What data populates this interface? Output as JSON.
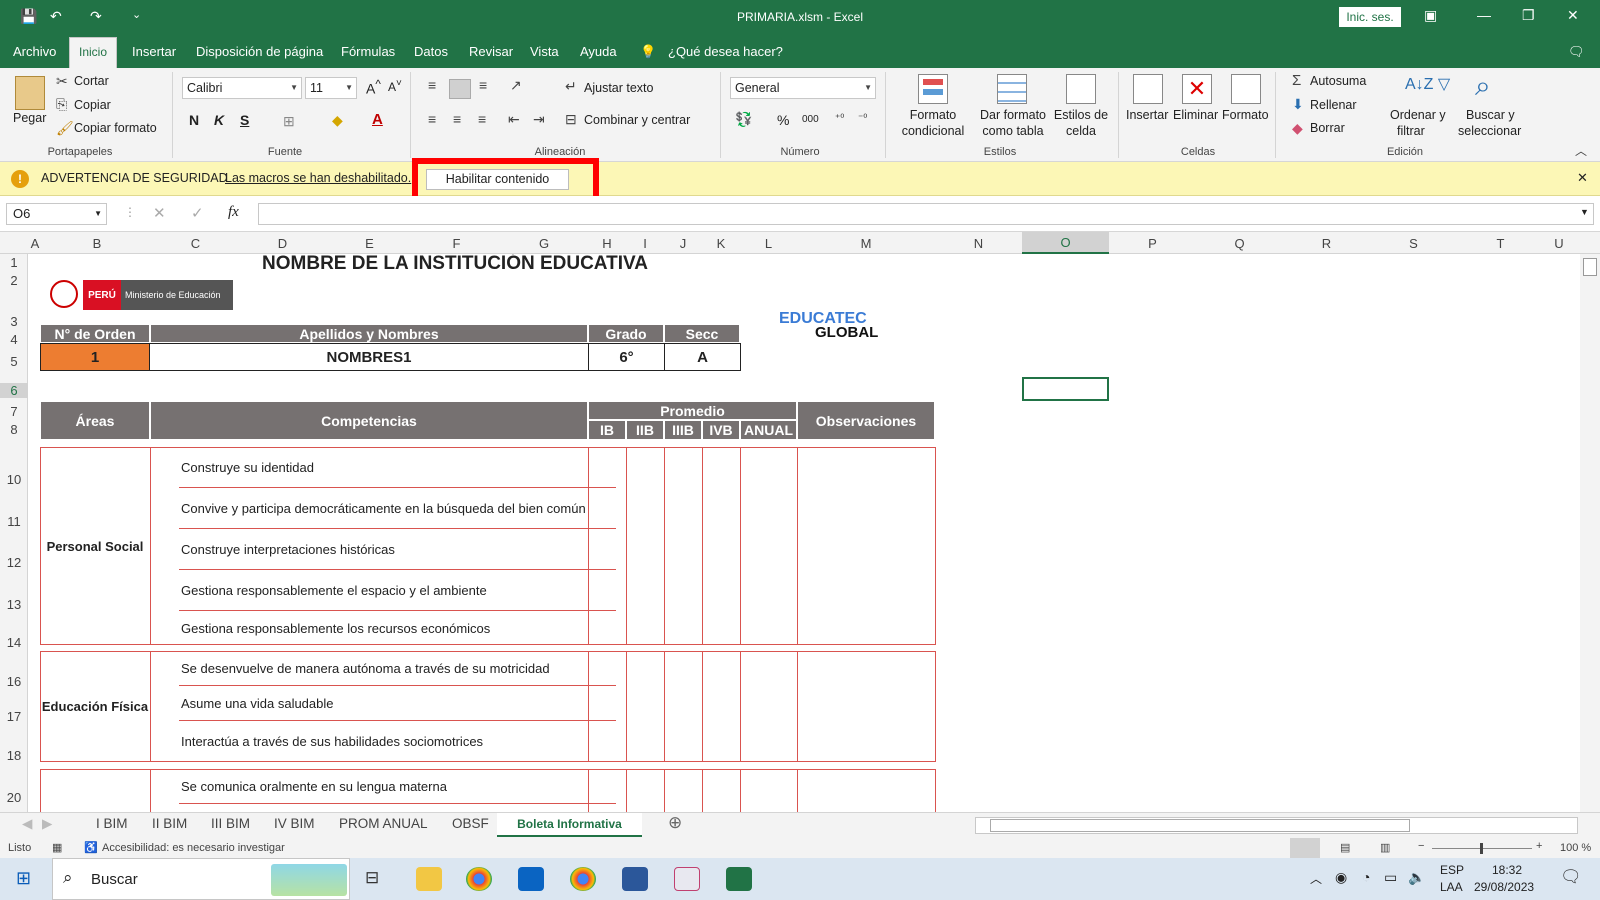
{
  "window": {
    "title": "PRIMARIA.xlsm  -  Excel",
    "signin": "Inic. ses."
  },
  "tabs": [
    "Archivo",
    "Inicio",
    "Insertar",
    "Disposición de página",
    "Fórmulas",
    "Datos",
    "Revisar",
    "Vista",
    "Ayuda"
  ],
  "tell_me": "¿Qué desea hacer?",
  "ribbon": {
    "clipboard": {
      "paste": "Pegar",
      "cut": "Cortar",
      "copy": "Copiar",
      "format_painter": "Copiar formato",
      "group": "Portapapeles"
    },
    "font": {
      "name": "Calibri",
      "size": "11",
      "bold": "N",
      "italic": "K",
      "underline": "S",
      "group": "Fuente"
    },
    "alignment": {
      "wrap": "Ajustar texto",
      "merge": "Combinar y centrar",
      "group": "Alineación"
    },
    "number": {
      "format": "General",
      "group": "Número"
    },
    "styles": {
      "conditional_1": "Formato",
      "conditional_2": "condicional",
      "table_1": "Dar formato",
      "table_2": "como tabla",
      "cell_1": "Estilos de",
      "cell_2": "celda",
      "group": "Estilos"
    },
    "cells": {
      "insert": "Insertar",
      "delete": "Eliminar",
      "format": "Formato",
      "group": "Celdas"
    },
    "editing": {
      "autosum": "Autosuma",
      "fill": "Rellenar",
      "clear": "Borrar",
      "sort_1": "Ordenar y",
      "sort_2": "filtrar",
      "find_1": "Buscar y",
      "find_2": "seleccionar",
      "group": "Edición"
    }
  },
  "security": {
    "title": "ADVERTENCIA DE SEGURIDAD",
    "message": "Las macros se han deshabilitado.",
    "button": "Habilitar contenido"
  },
  "formula_bar": {
    "name_box": "O6",
    "fx": "fx",
    "value": ""
  },
  "columns": [
    "A",
    "B",
    "C",
    "D",
    "E",
    "F",
    "G",
    "H",
    "I",
    "J",
    "K",
    "L",
    "M",
    "N",
    "O",
    "P",
    "Q",
    "R",
    "S",
    "T",
    "U"
  ],
  "rows": [
    "1",
    "2",
    "3",
    "4",
    "5",
    "6",
    "7",
    "8",
    "10",
    "11",
    "12",
    "13",
    "14",
    "16",
    "17",
    "18",
    "20"
  ],
  "sheet": {
    "institution": "NOMBRE DE LA INSTITUCIÓN EDUCATIVA",
    "logo_peru": "PERÚ",
    "logo_minedu": "Ministerio de Educación",
    "logo_educatec_1": "EDUCATEC",
    "logo_educatec_2": "GLOBAL",
    "student_headers": [
      "N° de Orden",
      "Apellidos y Nombres",
      "Grado",
      "Secc"
    ],
    "student_values": [
      "1",
      "NOMBRES1",
      "6°",
      "A"
    ],
    "table_headers": {
      "areas": "Áreas",
      "competencias": "Competencias",
      "promedio": "Promedio",
      "observaciones": "Observaciones",
      "periods": [
        "IB",
        "IIB",
        "IIIB",
        "IVB",
        "ANUAL"
      ]
    },
    "areas": [
      {
        "name": "Personal Social",
        "competencies": [
          "Construye su identidad",
          "Convive y participa democráticamente en la búsqueda del bien común",
          "Construye interpretaciones históricas",
          "Gestiona responsablemente el espacio y el ambiente",
          "Gestiona responsablemente los recursos económicos"
        ]
      },
      {
        "name": "Educación Física",
        "competencies": [
          "Se desenvuelve de manera autónoma a través de su motricidad",
          "Asume una vida saludable",
          "Interactúa a través de sus habilidades sociomotrices"
        ]
      },
      {
        "name": "",
        "competencies": [
          "Se comunica oralmente en su lengua materna"
        ]
      }
    ]
  },
  "sheet_tabs": [
    "I BIM",
    "II BIM",
    "III BIM",
    "IV BIM",
    "PROM ANUAL",
    "OBSF",
    "Boleta Informativa"
  ],
  "status": {
    "ready": "Listo",
    "accessibility": "Accesibilidad: es necesario investigar",
    "zoom": "100 %"
  },
  "taskbar": {
    "search": "Buscar",
    "lang_1": "ESP",
    "lang_2": "LAA",
    "time": "18:32",
    "date": "29/08/2023"
  }
}
